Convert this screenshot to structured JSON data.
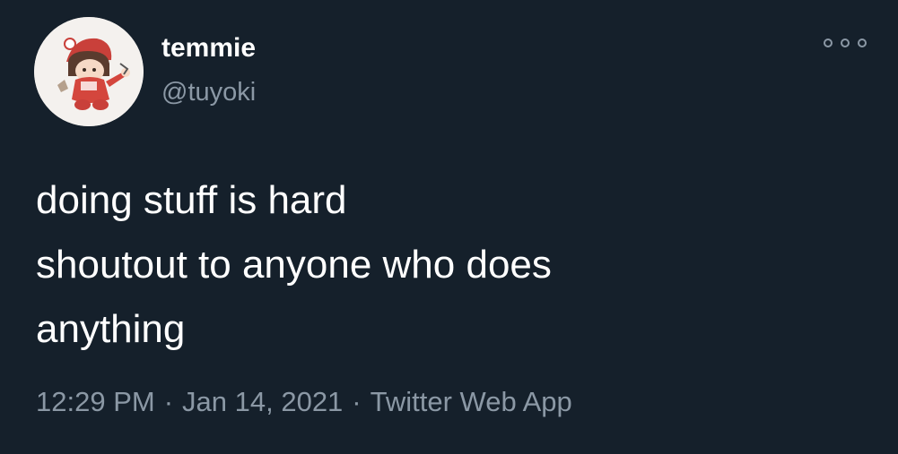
{
  "author": {
    "display_name": "temmie",
    "handle": "@tuyoki",
    "avatar_icon": "chibi-character-avatar"
  },
  "more_icon": "more-options-icon",
  "tweet": {
    "lines": [
      "doing stuff is hard",
      "shoutout to anyone who does",
      "anything"
    ]
  },
  "meta": {
    "time": "12:29 PM",
    "separator": "·",
    "date": "Jan 14, 2021",
    "source": "Twitter Web App"
  },
  "colors": {
    "background": "#15202b",
    "text": "#ffffff",
    "secondary": "#8b98a5"
  }
}
